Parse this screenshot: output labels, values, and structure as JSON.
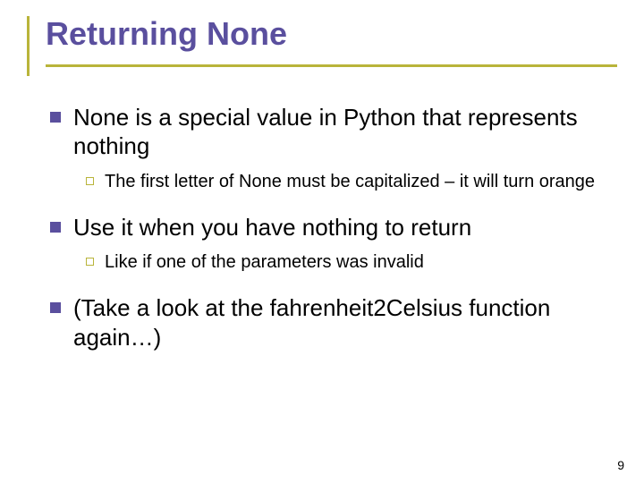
{
  "title": "Returning None",
  "bullets": [
    {
      "text": "None is a special value in Python that represents nothing",
      "sub": [
        "The first letter of None must be capitalized – it will turn orange"
      ]
    },
    {
      "text": "Use it when you have nothing to return",
      "sub": [
        "Like if one of the parameters was invalid"
      ]
    },
    {
      "text": "(Take a look at the fahrenheit2Celsius function again…)",
      "sub": []
    }
  ],
  "page_number": "9"
}
